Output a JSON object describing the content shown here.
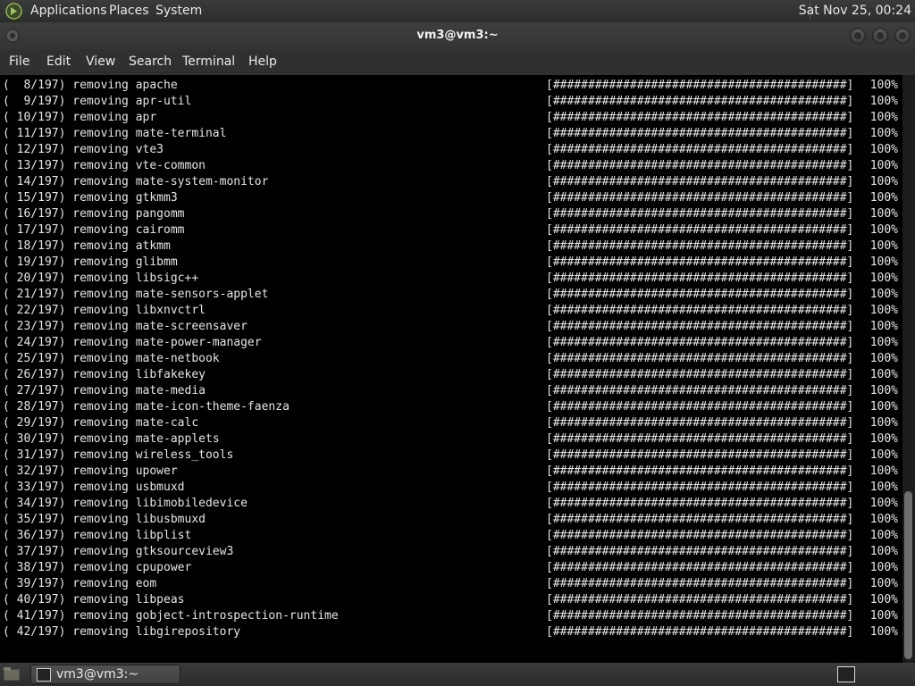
{
  "panel": {
    "menus": [
      "Applications",
      "Places",
      "System"
    ],
    "clock": "Sat Nov 25, 00:24"
  },
  "window": {
    "title": "vm3@vm3:~"
  },
  "menubar": [
    "File",
    "Edit",
    "View",
    "Search",
    "Terminal",
    "Help"
  ],
  "terminal": {
    "bar": "[##########################################]",
    "lines": [
      {
        "prefix": "(  8/197) removing apache",
        "pct": "100%"
      },
      {
        "prefix": "(  9/197) removing apr-util",
        "pct": "100%"
      },
      {
        "prefix": "( 10/197) removing apr",
        "pct": "100%"
      },
      {
        "prefix": "( 11/197) removing mate-terminal",
        "pct": "100%"
      },
      {
        "prefix": "( 12/197) removing vte3",
        "pct": "100%"
      },
      {
        "prefix": "( 13/197) removing vte-common",
        "pct": "100%"
      },
      {
        "prefix": "( 14/197) removing mate-system-monitor",
        "pct": "100%"
      },
      {
        "prefix": "( 15/197) removing gtkmm3",
        "pct": "100%"
      },
      {
        "prefix": "( 16/197) removing pangomm",
        "pct": "100%"
      },
      {
        "prefix": "( 17/197) removing cairomm",
        "pct": "100%"
      },
      {
        "prefix": "( 18/197) removing atkmm",
        "pct": "100%"
      },
      {
        "prefix": "( 19/197) removing glibmm",
        "pct": "100%"
      },
      {
        "prefix": "( 20/197) removing libsigc++",
        "pct": "100%"
      },
      {
        "prefix": "( 21/197) removing mate-sensors-applet",
        "pct": "100%"
      },
      {
        "prefix": "( 22/197) removing libxnvctrl",
        "pct": "100%"
      },
      {
        "prefix": "( 23/197) removing mate-screensaver",
        "pct": "100%"
      },
      {
        "prefix": "( 24/197) removing mate-power-manager",
        "pct": "100%"
      },
      {
        "prefix": "( 25/197) removing mate-netbook",
        "pct": "100%"
      },
      {
        "prefix": "( 26/197) removing libfakekey",
        "pct": "100%"
      },
      {
        "prefix": "( 27/197) removing mate-media",
        "pct": "100%"
      },
      {
        "prefix": "( 28/197) removing mate-icon-theme-faenza",
        "pct": "100%"
      },
      {
        "prefix": "( 29/197) removing mate-calc",
        "pct": "100%"
      },
      {
        "prefix": "( 30/197) removing mate-applets",
        "pct": "100%"
      },
      {
        "prefix": "( 31/197) removing wireless_tools",
        "pct": "100%"
      },
      {
        "prefix": "( 32/197) removing upower",
        "pct": "100%"
      },
      {
        "prefix": "( 33/197) removing usbmuxd",
        "pct": "100%"
      },
      {
        "prefix": "( 34/197) removing libimobiledevice",
        "pct": "100%"
      },
      {
        "prefix": "( 35/197) removing libusbmuxd",
        "pct": "100%"
      },
      {
        "prefix": "( 36/197) removing libplist",
        "pct": "100%"
      },
      {
        "prefix": "( 37/197) removing gtksourceview3",
        "pct": "100%"
      },
      {
        "prefix": "( 38/197) removing cpupower",
        "pct": "100%"
      },
      {
        "prefix": "( 39/197) removing eom",
        "pct": "100%"
      },
      {
        "prefix": "( 40/197) removing libpeas",
        "pct": "100%"
      },
      {
        "prefix": "( 41/197) removing gobject-introspection-runtime",
        "pct": "100%"
      },
      {
        "prefix": "( 42/197) removing libgirepository",
        "pct": "100%"
      }
    ]
  },
  "taskbar": {
    "task_label": "vm3@vm3:~"
  },
  "colors": {
    "panel": "#2f3130",
    "terminal_bg": "#000000",
    "terminal_fg": "#e6e6e6"
  }
}
